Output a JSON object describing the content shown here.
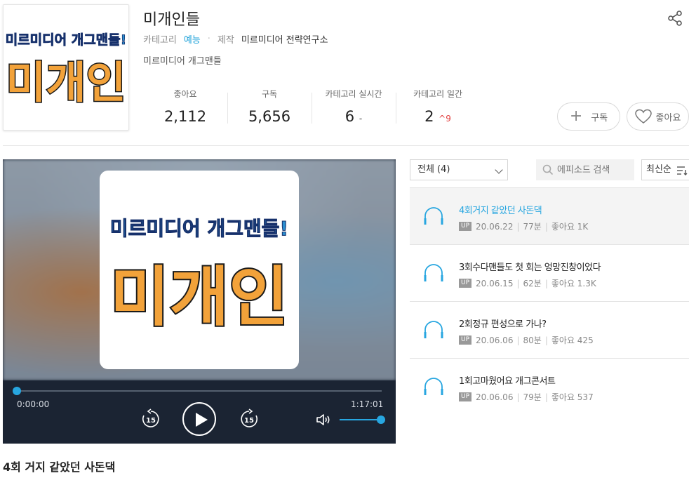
{
  "podcast": {
    "title": "미개인들",
    "category_label": "카테고리",
    "category_value": "예능",
    "producer_label": "제작",
    "producer_value": "미르미디어 전략연구소",
    "description": "미르미디어 개그맨들",
    "cover_line1": "미르미디어 개그맨들!",
    "cover_line2": "미개인"
  },
  "stats": [
    {
      "label": "좋아요",
      "value": "2,112",
      "trend": "",
      "change": ""
    },
    {
      "label": "구독",
      "value": "5,656",
      "trend": "",
      "change": ""
    },
    {
      "label": "카테고리 실시간",
      "value": "6",
      "trend": "-",
      "change": ""
    },
    {
      "label": "카테고리 일간",
      "value": "2",
      "trend": "",
      "change": "^9"
    }
  ],
  "actions": {
    "subscribe_label": "구독",
    "like_label": "좋아요"
  },
  "player": {
    "current_time": "0:00:00",
    "total_time": "1:17:01",
    "skip_seconds": "15",
    "progress": 0,
    "volume": 1.0
  },
  "now_playing_title": "4회 거지 같았던 사돈댁",
  "episode_filter": {
    "selected": "전체 (4)",
    "search_placeholder": "에피소드 검색",
    "sort_label": "최신순"
  },
  "episodes": [
    {
      "title": "4회거지 같았던 사돈댁",
      "badge": "UP",
      "date": "20.06.22",
      "duration": "77분",
      "likes": "좋아요 1K",
      "active": true
    },
    {
      "title": "3회수다맨들도 첫 회는 엉망진창이었다",
      "badge": "UP",
      "date": "20.06.15",
      "duration": "62분",
      "likes": "좋아요 1.3K",
      "active": false
    },
    {
      "title": "2회정규 편성으로 가나?",
      "badge": "UP",
      "date": "20.06.06",
      "duration": "80분",
      "likes": "좋아요 425",
      "active": false
    },
    {
      "title": "1회고마웠어요 개그콘서트",
      "badge": "UP",
      "date": "20.06.06",
      "duration": "79분",
      "likes": "좋아요 537",
      "active": false
    }
  ],
  "colors": {
    "accent": "#27a6e0",
    "player_bg": "#1b2433",
    "rank_up": "#e23c3c"
  }
}
